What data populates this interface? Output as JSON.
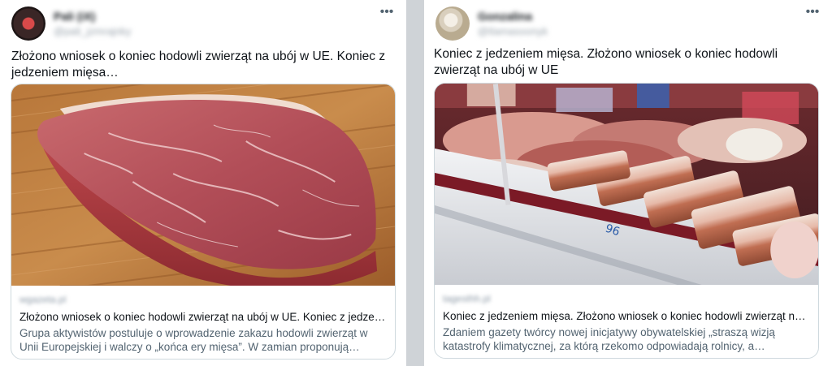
{
  "tweets": [
    {
      "author": {
        "display_name": "Pali (iX)",
        "handle": "@pali_jzmrajnky"
      },
      "more_icon": "more-horizontal-icon",
      "text": "Złożono wniosek o koniec hodowli zwierząt na ubój w UE. Koniec z jedzeniem mięsa…",
      "card": {
        "domain": "wgazeta.pl",
        "title": "Złożono wniosek o koniec hodowli zwierząt na ubój w UE. Koniec z jedzeniem mięsa…",
        "description": "Grupa aktywistów postuluje o wprowadzenie zakazu hodowli zwierząt w Unii Europejskiej i walczy o „końca ery mięsa”. W zamian proponują konsumentom…"
      }
    },
    {
      "author": {
        "display_name": "Gonzalina",
        "handle": "@tlamasoonyk"
      },
      "more_icon": "more-horizontal-icon",
      "text": "Koniec z jedzeniem mięsa. Złożono wniosek o koniec hodowli zwierząt na ubój w UE",
      "card": {
        "domain": "tagesthh.pl",
        "title": "Koniec z jedzeniem mięsa. Złożono wniosek o koniec hodowli zwierząt na ubój w UE",
        "description": "Zdaniem gazety twórcy nowej inicjatywy obywatelskiej „straszą wizją katastrofy klimatycznej, za którą rzekomo odpowiadają rolnicy, a szczególnie …"
      }
    }
  ]
}
